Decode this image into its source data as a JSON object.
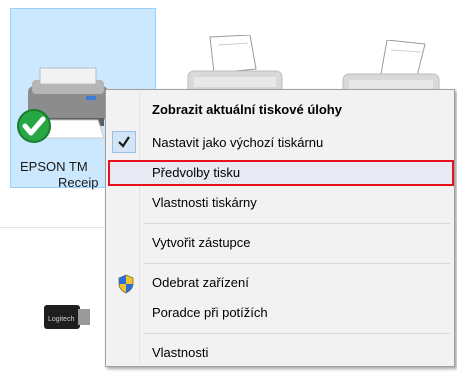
{
  "device": {
    "name_line1": "EPSON TM",
    "name_line2": "Receip",
    "status_icon": "green-check-icon"
  },
  "usb_device": {
    "brand": "Logitech",
    "icon": "usb-receiver-icon"
  },
  "context_menu": {
    "items": [
      {
        "label": "Zobrazit aktuální tiskové úlohy"
      },
      {
        "label": "Nastavit jako výchozí tiskárnu",
        "icon": "checkmark-icon"
      },
      {
        "label": "Předvolby tisku"
      },
      {
        "label": "Vlastnosti tiskárny"
      },
      {
        "label": "Vytvořit zástupce"
      },
      {
        "label": "Odebrat zařízení",
        "icon": "uac-shield-icon"
      },
      {
        "label": "Poradce při potížích"
      },
      {
        "label": "Vlastnosti"
      }
    ]
  },
  "colors": {
    "selection_tile": "#cce8ff",
    "menu_background": "#f2f2f2",
    "highlight_border": "#e8101a"
  }
}
